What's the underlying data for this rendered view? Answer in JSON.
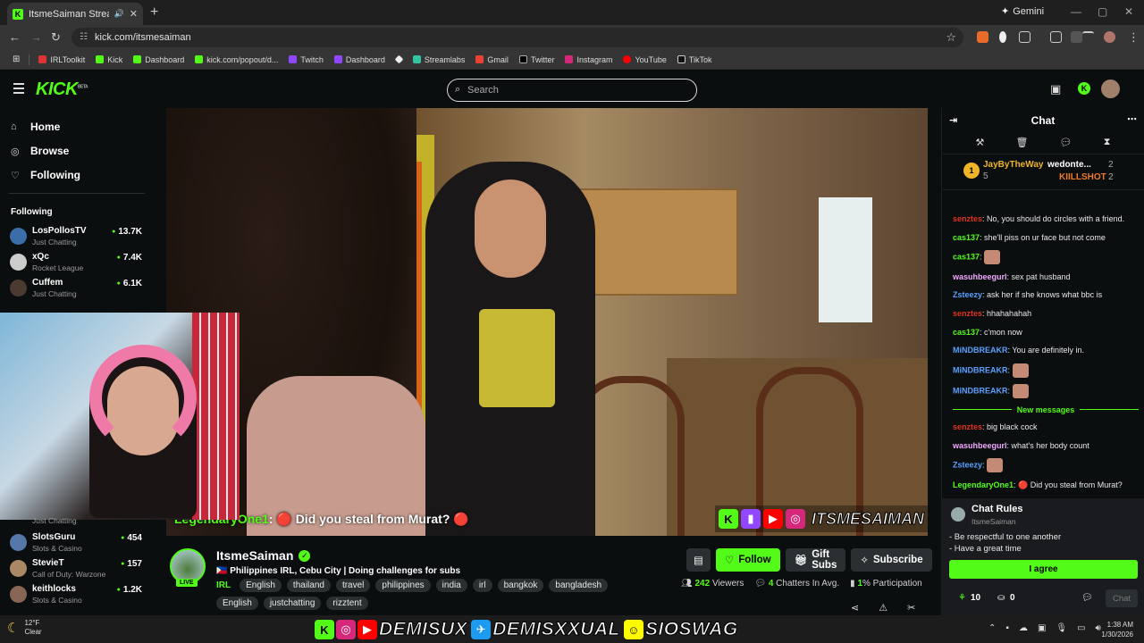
{
  "browser": {
    "tab_title": "ItsmeSaiman Stream - Watc",
    "new_tab_symbol": "+",
    "gemini_label": "Gemini",
    "url": "kick.com/itsmesaiman",
    "bookmarks": [
      "IRLToolkit",
      "Kick",
      "Dashboard",
      "kick.com/popout/d...",
      "Twitch",
      "Dashboard",
      "",
      "Streamlabs",
      "Gmail",
      "Twitter",
      "Instagram",
      "YouTube",
      "TikTok"
    ]
  },
  "header": {
    "logo": "KICK",
    "logo_badge": "BETA",
    "search_placeholder": "Search"
  },
  "sidebar": {
    "nav": [
      {
        "label": "Home",
        "icon": "home-icon"
      },
      {
        "label": "Browse",
        "icon": "compass-icon"
      },
      {
        "label": "Following",
        "icon": "heart-icon"
      }
    ],
    "following_label": "Following",
    "channels": [
      {
        "name": "LosPollosTV",
        "category": "Just Chatting",
        "viewers": "13.7K",
        "color": "#3b6ea8"
      },
      {
        "name": "xQc",
        "category": "Rocket League",
        "viewers": "7.4K",
        "color": "#cccccc"
      },
      {
        "name": "Cuffem",
        "category": "Just Chatting",
        "viewers": "6.1K",
        "color": "#4a3a30"
      }
    ],
    "channels_below": [
      {
        "name": "",
        "category": "Just Chatting",
        "viewers": "",
        "color": "#333"
      },
      {
        "name": "SlotsGuru",
        "category": "Slots & Casino",
        "viewers": "454",
        "color": "#5577aa"
      },
      {
        "name": "StevieT",
        "category": "Call of Duty: Warzone",
        "viewers": "157",
        "color": "#aa8866"
      },
      {
        "name": "keithlocks",
        "category": "Slots & Casino",
        "viewers": "1.2K",
        "color": "#886655"
      }
    ]
  },
  "video": {
    "overlay_user": "LegendaryOne1",
    "overlay_message": ": 🔴 Did you steal from Murat? 🔴",
    "brand_name": "ITSMESAIMAN"
  },
  "stream": {
    "live_label": "LIVE",
    "streamer": "ItsmeSaiman",
    "title": "🇵🇭 Philippines IRL, Cebu City | Doing challenges for subs",
    "category": "IRL",
    "tags": [
      "English",
      "thailand",
      "travel",
      "philippines",
      "india",
      "irl",
      "bangkok",
      "bangladesh",
      "English",
      "justchatting",
      "rizztent"
    ],
    "follow_label": "Follow",
    "gift_label": "Gift Subs",
    "subscribe_label": "Subscribe",
    "viewers": "242",
    "viewers_label": "Viewers",
    "chatters": "4",
    "chatters_label": "Chatters In Avg.",
    "participation": "1",
    "participation_label": "% Participation"
  },
  "chat": {
    "title": "Chat",
    "leaderboard": [
      {
        "rank": "1",
        "name": "JayByTheWay",
        "count": "5"
      },
      {
        "name": "wedonte...",
        "count": "2"
      },
      {
        "name": "KIILLSHOT",
        "count": "2"
      }
    ],
    "messages": [
      {
        "user": "senztes",
        "color": "#e0341e",
        "text": ": No, you should do circles with a friend."
      },
      {
        "user": "cas137",
        "color": "#53fc18",
        "text": ": she'll piss on ur face but not come"
      },
      {
        "user": "cas137",
        "color": "#53fc18",
        "text": ": ",
        "emote": true
      },
      {
        "user": "wasuhbeegurl",
        "color": "#f0a8ff",
        "text": ": sex pat husband"
      },
      {
        "user": "Zsteezy",
        "color": "#5aa0ff",
        "text": ": ask her if she knows what bbc is"
      },
      {
        "user": "senztes",
        "color": "#e0341e",
        "text": ": hhahahahah"
      },
      {
        "user": "cas137",
        "color": "#53fc18",
        "text": ": c'mon now"
      },
      {
        "user": "MiNDBREAKR",
        "color": "#5aa0ff",
        "text": ": You are definitely in."
      },
      {
        "user": "MiNDBREAKR",
        "color": "#5aa0ff",
        "text": ": ",
        "emote": true
      },
      {
        "user": "MiNDBREAKR",
        "color": "#5aa0ff",
        "text": ": ",
        "emote": true
      }
    ],
    "new_messages_label": "New messages",
    "messages_after": [
      {
        "user": "senztes",
        "color": "#e0341e",
        "text": ": big black cock"
      },
      {
        "user": "wasuhbeegurl",
        "color": "#f0a8ff",
        "text": ": what's her body count"
      },
      {
        "user": "Zsteezy",
        "color": "#5aa0ff",
        "text": ": ",
        "emote": true
      },
      {
        "user": "LegendaryOne1",
        "color": "#53fc18",
        "text": ": 🔴 Did you steal from Murat?"
      }
    ],
    "rules_title": "Chat Rules",
    "rules_streamer": "ItsmeSaiman",
    "rules": [
      "- Be respectful to one another",
      "- Have a great time"
    ],
    "agree_label": "I agree",
    "points": "10",
    "count2": "0",
    "send_label": "Chat"
  },
  "taskbar": {
    "temp": "12°F",
    "weather": "Clear",
    "banner_words": [
      "DEMISUX",
      "DEMISXXUAL",
      "SIOSWAG"
    ],
    "time": "1:38 AM",
    "date": "1/30/2026"
  }
}
